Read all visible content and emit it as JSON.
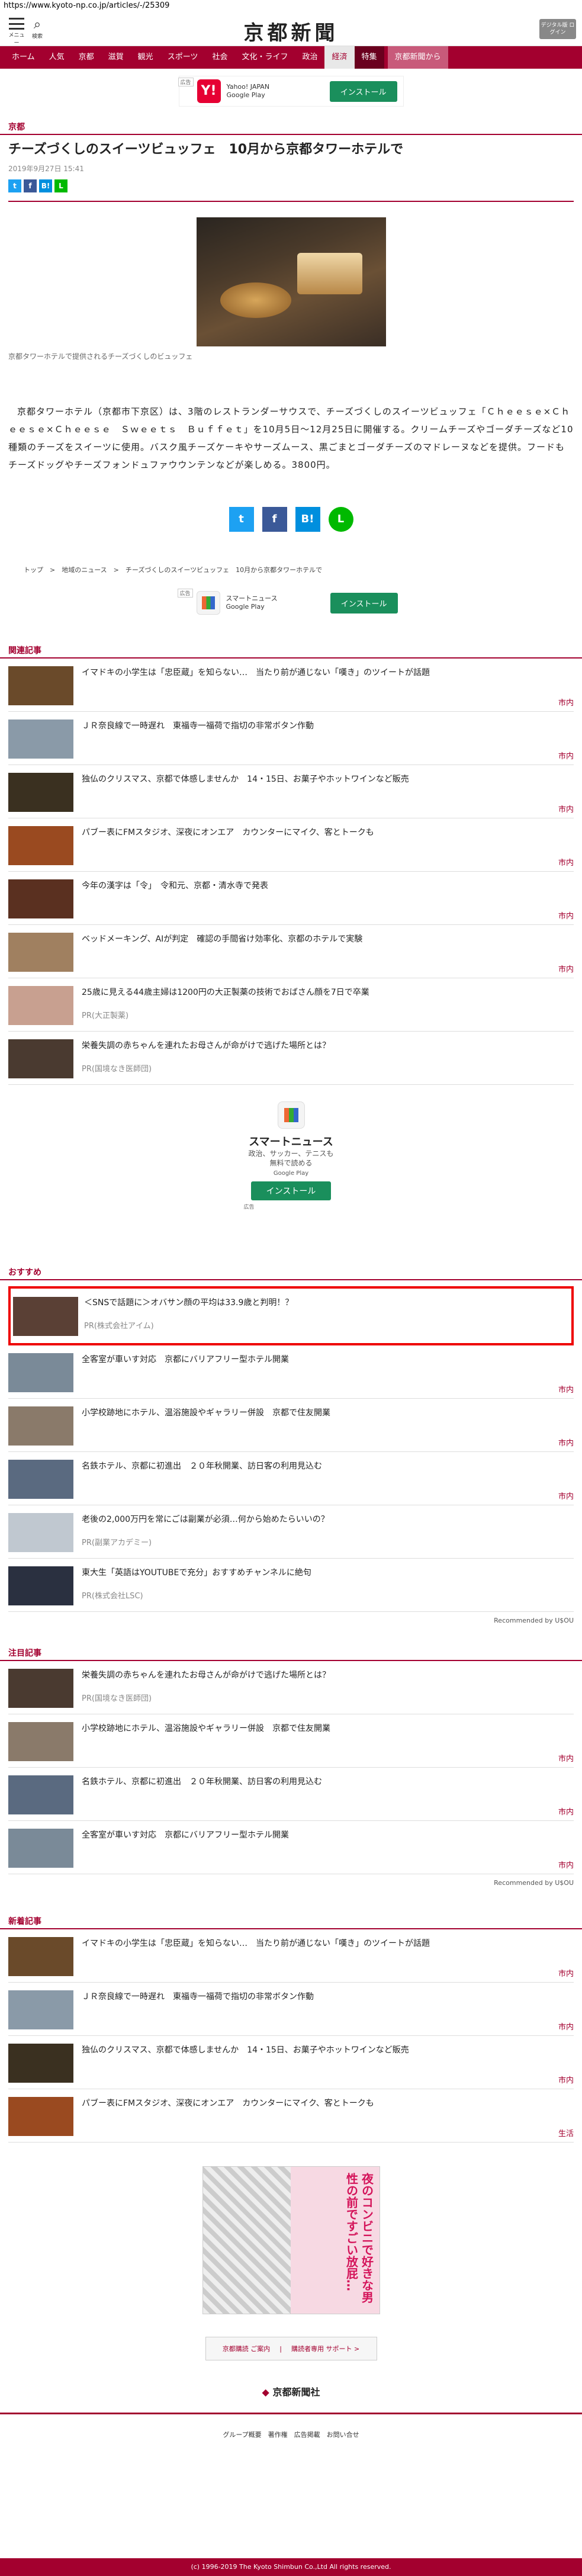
{
  "url": "https://www.kyoto-np.co.jp/articles/-/25309",
  "header": {
    "menu_label": "メニュー",
    "search_label": "検索",
    "logo": "京都新聞",
    "digital_label": "デジタル版\nログイン"
  },
  "nav": [
    "ホーム",
    "人気",
    "京都",
    "滋賀",
    "観光",
    "スポーツ",
    "社会",
    "文化・ライフ",
    "政治",
    "経済",
    "特集",
    "京都新聞から"
  ],
  "ad_top": {
    "name": "Yahoo! JAPAN",
    "store": "Google Play",
    "install": "インストール",
    "label": "広告"
  },
  "section_label": "京都",
  "article": {
    "title": "チーズづくしのスイーツビュッフェ　10月から京都タワーホテルで",
    "date": "2019年9月27日 15:41",
    "share": [
      "t",
      "f",
      "B!",
      "L"
    ],
    "caption": "京都タワーホテルで提供されるチーズづくしのビュッフェ",
    "body": "京都タワーホテル（京都市下京区）は、3階のレストランダーサウスで、チーズづくしのスイーツビュッフェ「Ｃｈｅｅｓｅ×Ｃｈｅｅｓｅ×Ｃｈｅｅｓｅ　Ｓｗｅｅｔｓ　Ｂｕｆｆｅｔ」を10月5日～12月25日に開催する。クリームチーズやゴーダチーズなど10種類のチーズをスイーツに使用。バスク風チーズケーキやサーズムース、黒ごまとゴーダチーズのマドレーヌなどを提供。フードもチーズドッグやチーズフォンドュファウウンテンなどが楽しめる。3800円。"
  },
  "breadcrumb": [
    "トップ",
    ">",
    "地域のニュース",
    ">",
    "チーズづくしのスイーツビュッフェ　10月から京都タワーホテルで"
  ],
  "ad_mid": {
    "name": "スマートニュース",
    "store": "Google Play",
    "install": "インストール",
    "label": "広告"
  },
  "related": {
    "heading": "関連記事",
    "items": [
      {
        "text": "イマドキの小学生は「忠臣蔵」を知らない…　当たり前が通じない「嘆き」のツイートが話題",
        "cat": "市内"
      },
      {
        "text": "ＪＲ奈良線で一時遅れ　東福寺一福荷で指切の非常ボタン作動",
        "cat": "市内"
      },
      {
        "text": "独仏のクリスマス、京都で体感しませんか　14・15日、お菓子やホットワインなど販売",
        "cat": "市内"
      },
      {
        "text": "パブー表にFMスタジオ、深夜にオンエア　カウンターにマイク、客とトークも",
        "cat": "市内"
      },
      {
        "text": "今年の漢字は「令」　令和元、京都・清水寺で発表",
        "cat": "市内"
      },
      {
        "text": "ベッドメーキング、AIが判定　確認の手間省け効率化、京都のホテルで実験",
        "cat": "市内"
      },
      {
        "text": "25歳に見える44歳主婦は1200円の大正製薬の技術でおばさん顔を7日で卒業",
        "pr": "PR(大正製薬)"
      },
      {
        "text": "栄養失調の赤ちゃんを連れたお母さんが命がけで逃げた場所とは？",
        "pr": "PR(国境なき医師団)"
      }
    ]
  },
  "ad_big": {
    "name": "スマートニュース",
    "sub1": "政治、サッカー、テニスも",
    "sub2": "無料で読める",
    "store": "Google Play",
    "install": "インストール",
    "label": "広告"
  },
  "recommend": {
    "heading": "おすすめ",
    "items": [
      {
        "text": "＜SNSで話題に＞オバサン顔の平均は33.9歳と判明！？",
        "pr": "PR(株式会社アイム)"
      },
      {
        "text": "全客室が車いす対応　京都にバリアフリー型ホテル開業",
        "cat": "市内"
      },
      {
        "text": "小学校跡地にホテル、温浴施設やギャラリー併設　京都で住友開業",
        "cat": "市内"
      },
      {
        "text": "名鉄ホテル、京都に初進出　２０年秋開業、訪日客の利用見込む",
        "cat": "市内"
      },
      {
        "text": "老後の2,000万円を常にごは副業が必須…何から始めたらいいの？",
        "pr": "PR(副業アカデミー)"
      },
      {
        "text": "東大生「英語はYOUTUBEで充分」おすすめチャンネルに絶句",
        "pr": "PR(株式会社LSC)"
      }
    ],
    "recommended_by": "Recommended by U$OU"
  },
  "attention": {
    "heading": "注目記事",
    "items": [
      {
        "text": "栄養失調の赤ちゃんを連れたお母さんが命がけで逃げた場所とは？",
        "pr": "PR(国境なき医師団)"
      },
      {
        "text": "小学校跡地にホテル、温浴施設やギャラリー併設　京都で住友開業",
        "cat": "市内"
      },
      {
        "text": "名鉄ホテル、京都に初進出　２０年秋開業、訪日客の利用見込む",
        "cat": "市内"
      },
      {
        "text": "全客室が車いす対応　京都にバリアフリー型ホテル開業",
        "cat": "市内"
      }
    ],
    "recommended_by": "Recommended by U$OU"
  },
  "latest": {
    "heading": "新着記事",
    "items": [
      {
        "text": "イマドキの小学生は「忠臣蔵」を知らない…　当たり前が通じない「嘆き」のツイートが話題",
        "cat": "市内"
      },
      {
        "text": "ＪＲ奈良線で一時遅れ　東福寺一福荷で指切の非常ボタン作動",
        "cat": "市内"
      },
      {
        "text": "独仏のクリスマス、京都で体感しませんか　14・15日、お菓子やホットワインなど販売",
        "cat": "市内"
      },
      {
        "text": "パブー表にFMスタジオ、深夜にオンエア　カウンターにマイク、客とトークも",
        "cat": "生活"
      }
    ]
  },
  "manga_ad": {
    "text": "夜のコンビニで好きな男性の前ですごい放屁…"
  },
  "footer": {
    "buttons": [
      "京都購読 ご案内",
      "|",
      "購読者専用 サポート >"
    ],
    "logo": "京都新聞社",
    "links": "グループ概要　著作権　広告掲載　お問い合せ",
    "copyright": "(c) 1996-2019 The Kyoto Shimbun Co.,Ltd All rights reserved."
  }
}
